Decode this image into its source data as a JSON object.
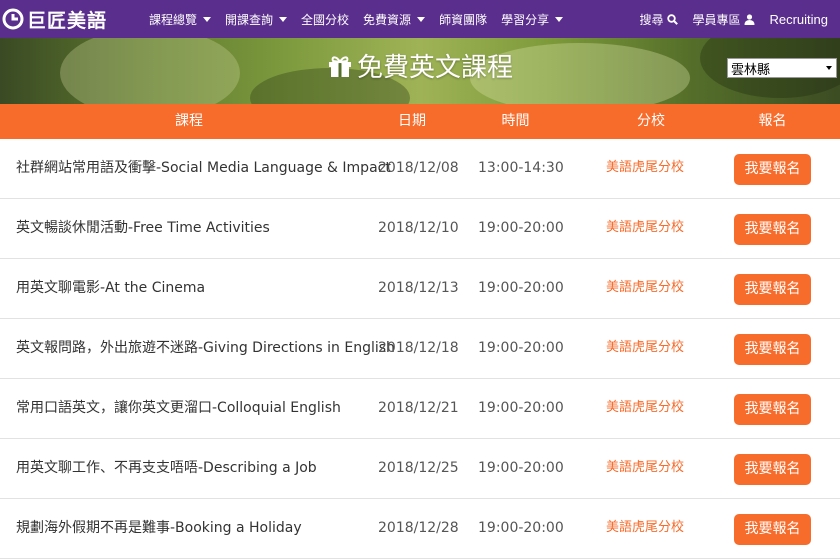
{
  "nav": {
    "logo_text": "巨匠美語",
    "menu": [
      {
        "label": "課程總覽",
        "dropdown": true
      },
      {
        "label": "開課查詢",
        "dropdown": true
      },
      {
        "label": "全國分校",
        "dropdown": false
      },
      {
        "label": "免費資源",
        "dropdown": true
      },
      {
        "label": "師資團隊",
        "dropdown": false
      },
      {
        "label": "學習分享",
        "dropdown": true
      }
    ],
    "search_label": "搜尋",
    "member_label": "學員專區",
    "recruiting_label": "Recruiting"
  },
  "banner": {
    "title": "免費英文課程",
    "region_selected": "雲林縣"
  },
  "table": {
    "headers": {
      "course": "課程",
      "date": "日期",
      "time": "時間",
      "branch": "分校",
      "signup": "報名"
    },
    "rows": [
      {
        "course": "社群網站常用語及衝擊-Social Media Language & Impact",
        "date": "2018/12/08",
        "time": "13:00-14:30",
        "branch": "美語虎尾分校",
        "button": "我要報名"
      },
      {
        "course": "英文暢談休閒活動-Free Time Activities",
        "date": "2018/12/10",
        "time": "19:00-20:00",
        "branch": "美語虎尾分校",
        "button": "我要報名"
      },
      {
        "course": "用英文聊電影-At the Cinema",
        "date": "2018/12/13",
        "time": "19:00-20:00",
        "branch": "美語虎尾分校",
        "button": "我要報名"
      },
      {
        "course": "英文報問路，外出旅遊不迷路-Giving Directions in English",
        "date": "2018/12/18",
        "time": "19:00-20:00",
        "branch": "美語虎尾分校",
        "button": "我要報名"
      },
      {
        "course": "常用口語英文，讓你英文更溜口-Colloquial English",
        "date": "2018/12/21",
        "time": "19:00-20:00",
        "branch": "美語虎尾分校",
        "button": "我要報名"
      },
      {
        "course": "用英文聊工作、不再支支唔唔-Describing a Job",
        "date": "2018/12/25",
        "time": "19:00-20:00",
        "branch": "美語虎尾分校",
        "button": "我要報名"
      },
      {
        "course": "規劃海外假期不再是難事-Booking a Holiday",
        "date": "2018/12/28",
        "time": "19:00-20:00",
        "branch": "美語虎尾分校",
        "button": "我要報名"
      }
    ]
  },
  "colors": {
    "nav_bg": "#5a2e8c",
    "accent": "#f76b2b"
  }
}
